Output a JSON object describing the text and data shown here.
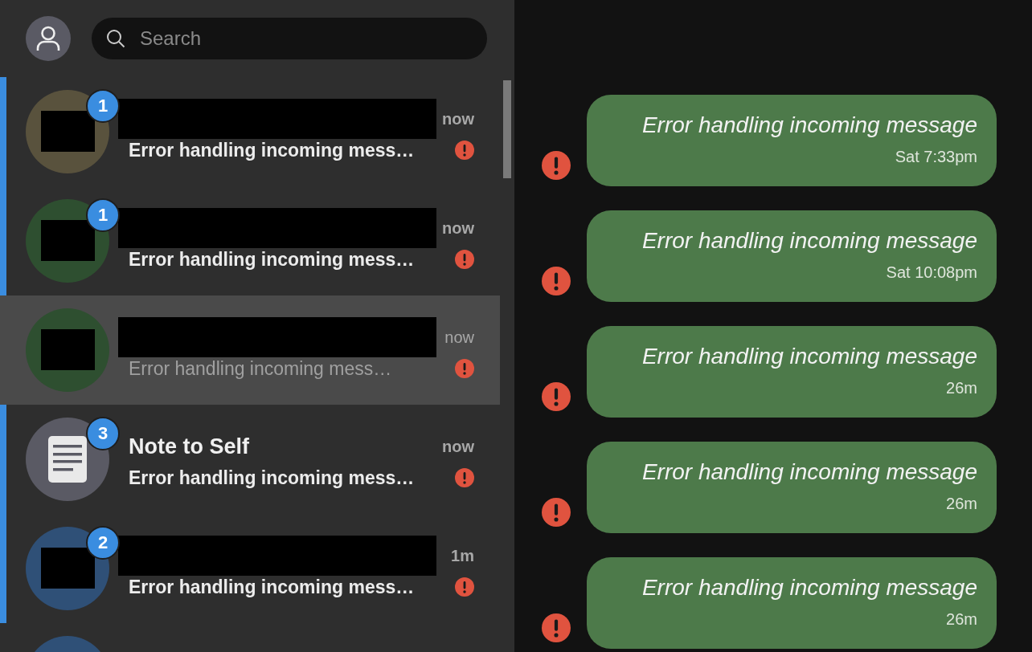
{
  "header": {
    "search": {
      "placeholder": "Search"
    }
  },
  "conversations": [
    {
      "kind": "redacted",
      "color": "#59523d",
      "badge": "1",
      "name_redacted": true,
      "time": "now",
      "preview": "Error handling incoming mess…",
      "error": true,
      "unread": true,
      "selected": false
    },
    {
      "kind": "redacted",
      "color": "#2e4f30",
      "badge": "1",
      "name_redacted": true,
      "time": "now",
      "preview": "Error handling incoming mess…",
      "error": true,
      "unread": true,
      "selected": false
    },
    {
      "kind": "redacted",
      "color": "#2e4f30",
      "name_redacted": true,
      "time": "now",
      "preview": "Error handling incoming mess…",
      "error": true,
      "unread": false,
      "selected": true
    },
    {
      "kind": "note",
      "color": "#5a5a64",
      "badge": "3",
      "name": "Note to Self",
      "time": "now",
      "preview": "Error handling incoming mess…",
      "error": true,
      "unread": true,
      "selected": false
    },
    {
      "kind": "redacted",
      "color": "#2f5077",
      "badge": "2",
      "name_redacted": true,
      "time": "1m",
      "preview": "Error handling incoming mess…",
      "error": true,
      "unread": true,
      "selected": false
    },
    {
      "kind": "none",
      "color": "#2f5077"
    }
  ],
  "messages": [
    {
      "text": "Error handling incoming message",
      "time": "Sat 7:33pm",
      "error": true
    },
    {
      "text": "Error handling incoming message",
      "time": "Sat 10:08pm",
      "error": true
    },
    {
      "text": "Error handling incoming message",
      "time": "26m",
      "error": true
    },
    {
      "text": "Error handling incoming message",
      "time": "26m",
      "error": true
    },
    {
      "text": "Error handling incoming message",
      "time": "26m",
      "error": true
    }
  ]
}
